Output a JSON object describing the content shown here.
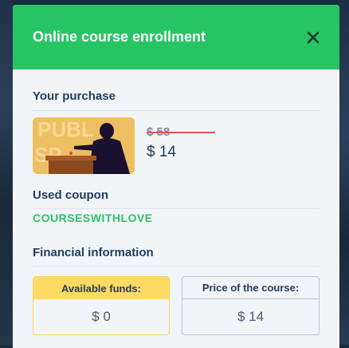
{
  "modal": {
    "title": "Online course enrollment",
    "close_icon": "close-icon"
  },
  "purchase": {
    "section_title": "Your purchase",
    "thumbnail_icon": "course-thumbnail",
    "thumbnail_text": "PUBLIC SPEAKING",
    "old_price": "$ 58",
    "new_price": "$ 14"
  },
  "coupon": {
    "section_title": "Used coupon",
    "code": "COURSESWITHLOVE"
  },
  "financial": {
    "section_title": "Financial information",
    "funds_label": "Available funds:",
    "funds_value": "$ 0",
    "price_label": "Price of the course:",
    "price_value": "$ 14"
  },
  "colors": {
    "header": "#27c464",
    "coupon": "#27c464",
    "strike": "#e05656",
    "funds_highlight": "#fddb63"
  }
}
